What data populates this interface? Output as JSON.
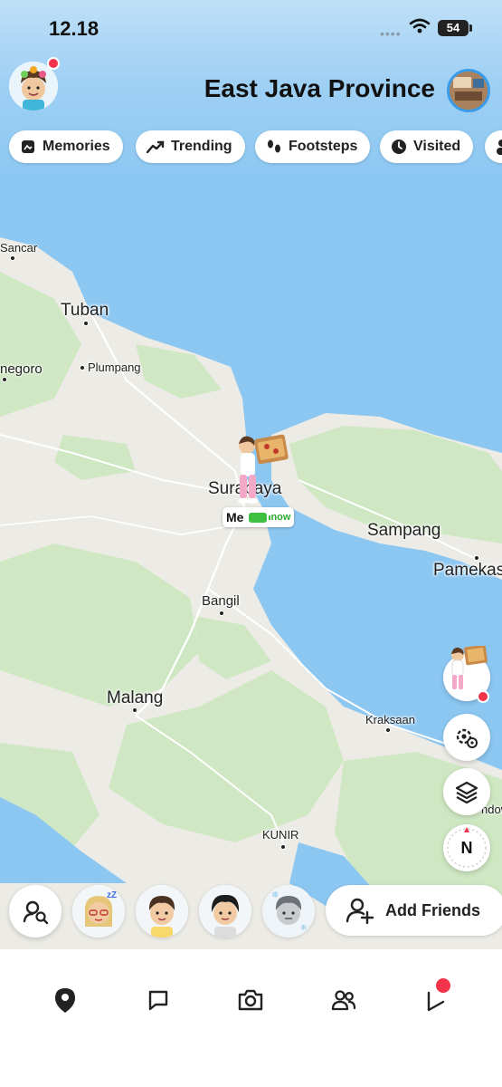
{
  "status_bar": {
    "time": "12.18",
    "battery": "54"
  },
  "header": {
    "title": "East Java Province"
  },
  "filters": [
    {
      "label": "Memories",
      "icon": "memories-icon"
    },
    {
      "label": "Trending",
      "icon": "trending-icon"
    },
    {
      "label": "Footsteps",
      "icon": "footsteps-icon"
    },
    {
      "label": "Visited",
      "icon": "visited-icon"
    }
  ],
  "map_labels": {
    "sancar": "Sancar",
    "tuban": "Tuban",
    "negoro": "negoro",
    "plumpang": "Plumpang",
    "surabaya": "Surabaya",
    "sampang": "Sampang",
    "pamekas": "Pamekas",
    "bangil": "Bangil",
    "malang": "Malang",
    "kraksaan": "Kraksaan",
    "kunir": "KUNIR",
    "ndow": "ndow"
  },
  "me_marker": {
    "label": "Me",
    "status": "now"
  },
  "controls": {
    "compass": "N"
  },
  "add_friends": {
    "label": "Add Friends"
  },
  "colors": {
    "water": "#8cc7f2",
    "land": "#ecebe6",
    "green": "#cfe8c3",
    "notification": "#f2334a",
    "accent": "#3a9be8"
  }
}
